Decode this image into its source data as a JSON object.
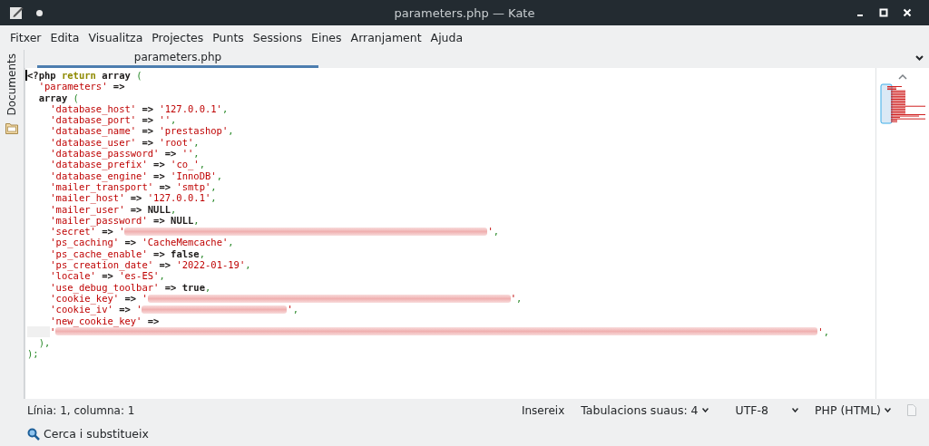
{
  "window": {
    "title": "parameters.php — Kate"
  },
  "menu": [
    "Fitxer",
    "Edita",
    "Visualitza",
    "Projectes",
    "Punts",
    "Sessions",
    "Eines",
    "Arranjament",
    "Ajuda"
  ],
  "sidebar": {
    "tabs": [
      {
        "label": "Documents",
        "selected": false
      }
    ]
  },
  "tabs": [
    {
      "label": "parameters.php",
      "selected": true
    }
  ],
  "editor": {
    "lines": [
      [
        {
          "kind": "plain",
          "text": "<?php "
        },
        {
          "kind": "keyword",
          "text": "return"
        },
        {
          "kind": "plain",
          "text": " array "
        },
        {
          "kind": "punct",
          "text": "("
        }
      ],
      [
        {
          "kind": "string",
          "text": "  'parameters'"
        },
        {
          "kind": "plain",
          "text": " =>"
        }
      ],
      [
        {
          "kind": "plain",
          "text": "  array "
        },
        {
          "kind": "punct",
          "text": "("
        }
      ],
      [
        {
          "kind": "string",
          "text": "    'database_host'"
        },
        {
          "kind": "plain",
          "text": " => "
        },
        {
          "kind": "string",
          "text": "'127.0.0.1'"
        },
        {
          "kind": "punct",
          "text": ","
        }
      ],
      [
        {
          "kind": "string",
          "text": "    'database_port'"
        },
        {
          "kind": "plain",
          "text": " => "
        },
        {
          "kind": "string",
          "text": "''"
        },
        {
          "kind": "punct",
          "text": ","
        }
      ],
      [
        {
          "kind": "string",
          "text": "    'database_name'"
        },
        {
          "kind": "plain",
          "text": " => "
        },
        {
          "kind": "string",
          "text": "'prestashop'"
        },
        {
          "kind": "punct",
          "text": ","
        }
      ],
      [
        {
          "kind": "string",
          "text": "    'database_user'"
        },
        {
          "kind": "plain",
          "text": " => "
        },
        {
          "kind": "string",
          "text": "'root'"
        },
        {
          "kind": "punct",
          "text": ","
        }
      ],
      [
        {
          "kind": "string",
          "text": "    'database_password'"
        },
        {
          "kind": "plain",
          "text": " => "
        },
        {
          "kind": "string",
          "text": "''"
        },
        {
          "kind": "punct",
          "text": ","
        }
      ],
      [
        {
          "kind": "string",
          "text": "    'database_prefix'"
        },
        {
          "kind": "plain",
          "text": " => "
        },
        {
          "kind": "string",
          "text": "'co_'"
        },
        {
          "kind": "punct",
          "text": ","
        }
      ],
      [
        {
          "kind": "string",
          "text": "    'database_engine'"
        },
        {
          "kind": "plain",
          "text": " => "
        },
        {
          "kind": "string",
          "text": "'InnoDB'"
        },
        {
          "kind": "punct",
          "text": ","
        }
      ],
      [
        {
          "kind": "string",
          "text": "    'mailer_transport'"
        },
        {
          "kind": "plain",
          "text": " => "
        },
        {
          "kind": "string",
          "text": "'smtp'"
        },
        {
          "kind": "punct",
          "text": ","
        }
      ],
      [
        {
          "kind": "string",
          "text": "    'mailer_host'"
        },
        {
          "kind": "plain",
          "text": " => "
        },
        {
          "kind": "string",
          "text": "'127.0.0.1'"
        },
        {
          "kind": "punct",
          "text": ","
        }
      ],
      [
        {
          "kind": "string",
          "text": "    'mailer_user'"
        },
        {
          "kind": "plain",
          "text": " => "
        },
        {
          "kind": "literal",
          "text": "NULL"
        },
        {
          "kind": "punct",
          "text": ","
        }
      ],
      [
        {
          "kind": "string",
          "text": "    'mailer_password'"
        },
        {
          "kind": "plain",
          "text": " => "
        },
        {
          "kind": "literal",
          "text": "NULL"
        },
        {
          "kind": "punct",
          "text": ","
        }
      ],
      [
        {
          "kind": "string",
          "text": "    'secret'"
        },
        {
          "kind": "plain",
          "text": " => "
        },
        {
          "kind": "string",
          "text": "'"
        },
        {
          "kind": "redacted"
        },
        {
          "kind": "redacted"
        },
        {
          "kind": "redacted"
        },
        {
          "kind": "redacted"
        },
        {
          "kind": "redacted"
        },
        {
          "kind": "redacted"
        },
        {
          "kind": "redacted"
        },
        {
          "kind": "redacted"
        },
        {
          "kind": "redacted"
        },
        {
          "kind": "redacted"
        },
        {
          "kind": "string",
          "text": "'"
        },
        {
          "kind": "punct",
          "text": ","
        }
      ],
      [
        {
          "kind": "string",
          "text": "    'ps_caching'"
        },
        {
          "kind": "plain",
          "text": " => "
        },
        {
          "kind": "string",
          "text": "'CacheMemcache'"
        },
        {
          "kind": "punct",
          "text": ","
        }
      ],
      [
        {
          "kind": "string",
          "text": "    'ps_cache_enable'"
        },
        {
          "kind": "plain",
          "text": " => "
        },
        {
          "kind": "literal",
          "text": "false"
        },
        {
          "kind": "punct",
          "text": ","
        }
      ],
      [
        {
          "kind": "string",
          "text": "    'ps_creation_date'"
        },
        {
          "kind": "plain",
          "text": " => "
        },
        {
          "kind": "string",
          "text": "'2022-01-19'"
        },
        {
          "kind": "punct",
          "text": ","
        }
      ],
      [
        {
          "kind": "string",
          "text": "    'locale'"
        },
        {
          "kind": "plain",
          "text": " => "
        },
        {
          "kind": "string",
          "text": "'es-ES'"
        },
        {
          "kind": "punct",
          "text": ","
        }
      ],
      [
        {
          "kind": "string",
          "text": "    'use_debug_toolbar'"
        },
        {
          "kind": "plain",
          "text": " => "
        },
        {
          "kind": "literal",
          "text": "true"
        },
        {
          "kind": "punct",
          "text": ","
        }
      ],
      [
        {
          "kind": "string",
          "text": "    'cookie_key'"
        },
        {
          "kind": "plain",
          "text": " => "
        },
        {
          "kind": "string",
          "text": "'"
        },
        {
          "kind": "redacted"
        },
        {
          "kind": "redacted"
        },
        {
          "kind": "redacted"
        },
        {
          "kind": "redacted"
        },
        {
          "kind": "redacted"
        },
        {
          "kind": "redacted"
        },
        {
          "kind": "redacted"
        },
        {
          "kind": "redacted"
        },
        {
          "kind": "redacted"
        },
        {
          "kind": "redacted"
        },
        {
          "kind": "string",
          "text": "'"
        },
        {
          "kind": "punct",
          "text": ","
        }
      ],
      [
        {
          "kind": "string",
          "text": "    'cookie_iv'"
        },
        {
          "kind": "plain",
          "text": " => "
        },
        {
          "kind": "string",
          "text": "'"
        },
        {
          "kind": "redacted"
        },
        {
          "kind": "redacted"
        },
        {
          "kind": "redacted"
        },
        {
          "kind": "redacted"
        },
        {
          "kind": "string",
          "text": "'"
        },
        {
          "kind": "punct",
          "text": ","
        }
      ],
      [
        {
          "kind": "string",
          "text": "    'new_cookie_key'"
        },
        {
          "kind": "plain",
          "text": " =>"
        }
      ],
      [
        {
          "kind": "wrap"
        },
        {
          "kind": "string",
          "text": "'"
        },
        {
          "kind": "redacted"
        },
        {
          "kind": "redacted"
        },
        {
          "kind": "redacted"
        },
        {
          "kind": "redacted"
        },
        {
          "kind": "redacted"
        },
        {
          "kind": "redacted"
        },
        {
          "kind": "redacted"
        },
        {
          "kind": "redacted"
        },
        {
          "kind": "redacted"
        },
        {
          "kind": "redacted"
        },
        {
          "kind": "redacted"
        },
        {
          "kind": "redacted"
        },
        {
          "kind": "redacted"
        },
        {
          "kind": "redacted"
        },
        {
          "kind": "redacted"
        },
        {
          "kind": "redacted"
        },
        {
          "kind": "redacted"
        },
        {
          "kind": "redacted"
        },
        {
          "kind": "redacted"
        },
        {
          "kind": "redacted"
        },
        {
          "kind": "redacted"
        },
        {
          "kind": "string",
          "text": "'"
        },
        {
          "kind": "punct",
          "text": ","
        }
      ],
      [
        {
          "kind": "punct",
          "text": "  ),"
        }
      ],
      [
        {
          "kind": "punct",
          "text": ");"
        }
      ]
    ]
  },
  "status_bar": {
    "position": "Línia: 1, columna: 1",
    "mode": "Insereix",
    "indent": "Tabulacions suaus: 4",
    "encoding": "UTF-8",
    "syntax": "PHP (HTML)"
  },
  "search_bar": {
    "label": "Cerca i substitueix"
  }
}
